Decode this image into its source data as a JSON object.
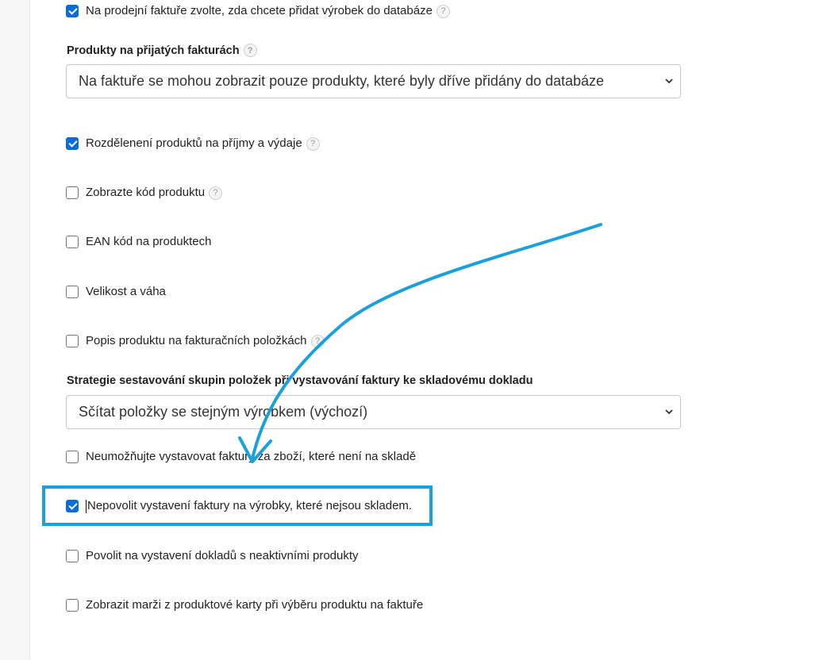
{
  "settings": {
    "sales_invoice_add_product": {
      "label": "Na prodejní faktuře zvolte, zda chcete přidat výrobek do databáze",
      "checked": true
    },
    "received_invoice_products": {
      "heading": "Produkty na přijatých fakturách",
      "selected": "Na faktuře se mohou zobrazit pouze produkty, které byly dříve přidány do databáze"
    },
    "split_income_expense": {
      "label": "Rozdělenení produktů na příjmy a výdaje",
      "checked": true
    },
    "show_product_code": {
      "label": "Zobrazte kód produktu",
      "checked": false
    },
    "ean_code": {
      "label": "EAN kód na produktech",
      "checked": false
    },
    "size_weight": {
      "label": "Velikost a váha",
      "checked": false
    },
    "product_description": {
      "label": "Popis produktu na fakturačních položkách",
      "checked": false
    },
    "grouping_strategy": {
      "heading": "Strategie sestavování skupin položek při vystavování faktury ke skladovému dokladu",
      "selected": "Sčítat položky se stejným výrobkem (výchozí)"
    },
    "block_out_of_stock_goods": {
      "label": "Neumožňujte vystavovat faktury za zboží, které není na skladě",
      "checked": false
    },
    "disallow_invoice_not_in_stock": {
      "label": "Nepovolit vystavení faktury na výrobky, které nejsou skladem.",
      "checked": true
    },
    "allow_inactive_products": {
      "label": "Povolit na vystavení dokladů s neaktivními produkty",
      "checked": false
    },
    "show_margin": {
      "label": "Zobrazit marži z produktové karty při výběru produktu na faktuře",
      "checked": false
    }
  },
  "help_glyph": "?",
  "icons": {
    "help": "question-circle-icon",
    "select": "chevron-down-icon"
  },
  "colors": {
    "checkbox_checked": "#0a6cd8",
    "annotation": "#1ba0dc"
  }
}
